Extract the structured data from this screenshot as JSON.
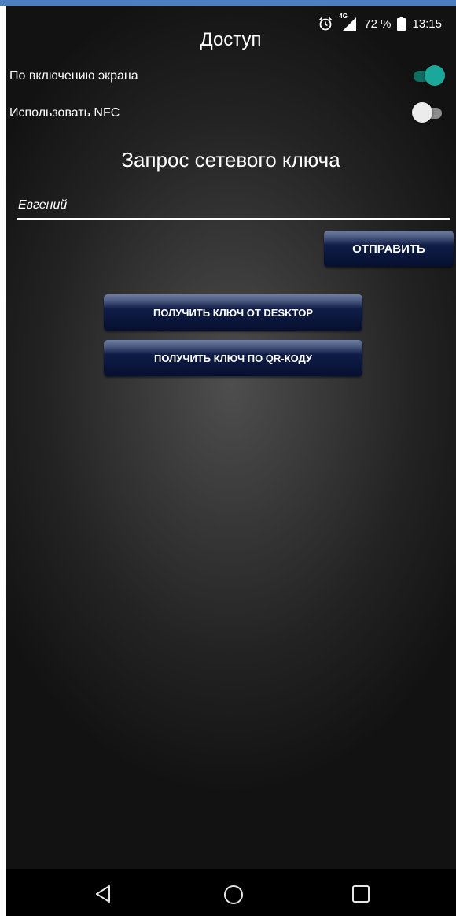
{
  "status_bar": {
    "network": "4G",
    "battery": "72 %",
    "time": "13:15",
    "icons": [
      "alarm-icon",
      "signal-icon",
      "battery-icon"
    ]
  },
  "app": {
    "title": "Доступ"
  },
  "settings": {
    "screen_on": {
      "label": "По включению экрана",
      "enabled": true
    },
    "nfc": {
      "label": "Использовать NFC",
      "enabled": false
    }
  },
  "key_request": {
    "title": "Запрос сетевого ключа",
    "name_value": "Евгений",
    "send_label": "ОТПРАВИТЬ"
  },
  "actions": {
    "desktop_label": "ПОЛУЧИТЬ КЛЮЧ ОТ DESKTOP",
    "qr_label": "ПОЛУЧИТЬ КЛЮЧ ПО QR-КОДУ"
  },
  "nav": [
    "back-icon",
    "home-icon",
    "recents-icon"
  ],
  "colors": {
    "accent": "#19a89a",
    "button": "#0f1d47",
    "window_border": "#4a7fc1"
  }
}
